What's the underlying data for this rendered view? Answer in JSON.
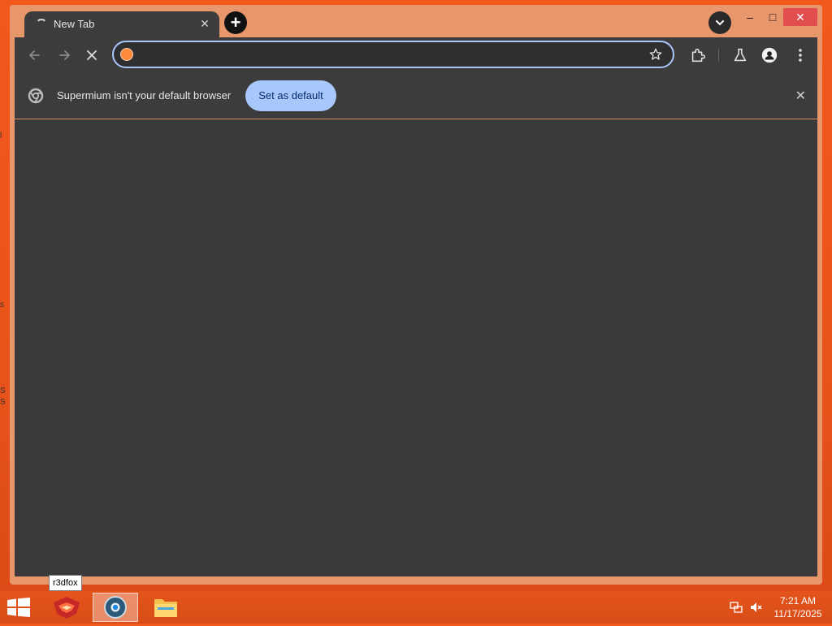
{
  "browser": {
    "tab": {
      "title": "New Tab",
      "close_glyph": "✕"
    },
    "new_tab_glyph": "+",
    "window_controls": {
      "minimize": "–",
      "maximize": "□",
      "close": "✕"
    },
    "toolbar": {
      "address_value": "",
      "address_placeholder": ""
    },
    "infobar": {
      "message": "Supermium isn't your default browser",
      "button": "Set as default",
      "close_glyph": "✕"
    }
  },
  "desktop": {
    "tooltip": "r3dfox",
    "edge_glyphs": [
      "l",
      "s",
      "S",
      "S"
    ]
  },
  "taskbar": {
    "clock": {
      "time": "7:21 AM",
      "date": "11/17/2025"
    }
  },
  "colors": {
    "accent": "#a8c7fa",
    "desktop": "#f0581c",
    "toolbar": "#3c3c3c",
    "content": "#3a3a3a"
  }
}
